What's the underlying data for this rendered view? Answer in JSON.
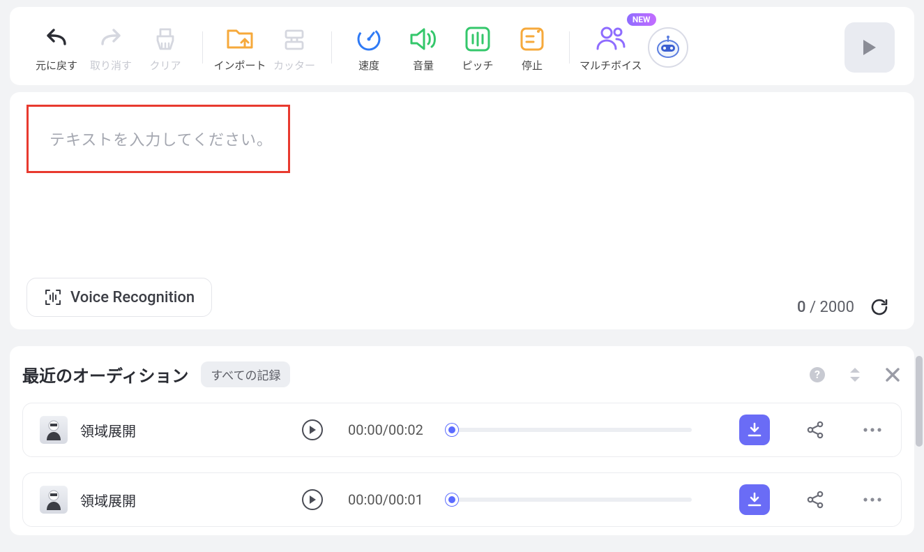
{
  "toolbar": {
    "undo": "元に戻す",
    "redo": "取り消す",
    "clear": "クリア",
    "import": "インポート",
    "cutter": "カッター",
    "speed": "速度",
    "volume": "音量",
    "pitch": "ピッチ",
    "pause": "停止",
    "multivoice": "マルチボイス",
    "new_badge": "NEW"
  },
  "editor": {
    "placeholder": "テキストを入力してください。",
    "voice_recognition": "Voice Recognition",
    "count_current": "0",
    "count_sep": " / ",
    "count_max": "2000"
  },
  "auditions": {
    "title": "最近のオーディション",
    "all_records": "すべての記録",
    "items": [
      {
        "name": "領域展開",
        "time": "00:00/00:02"
      },
      {
        "name": "領域展開",
        "time": "00:00/00:01"
      }
    ]
  }
}
